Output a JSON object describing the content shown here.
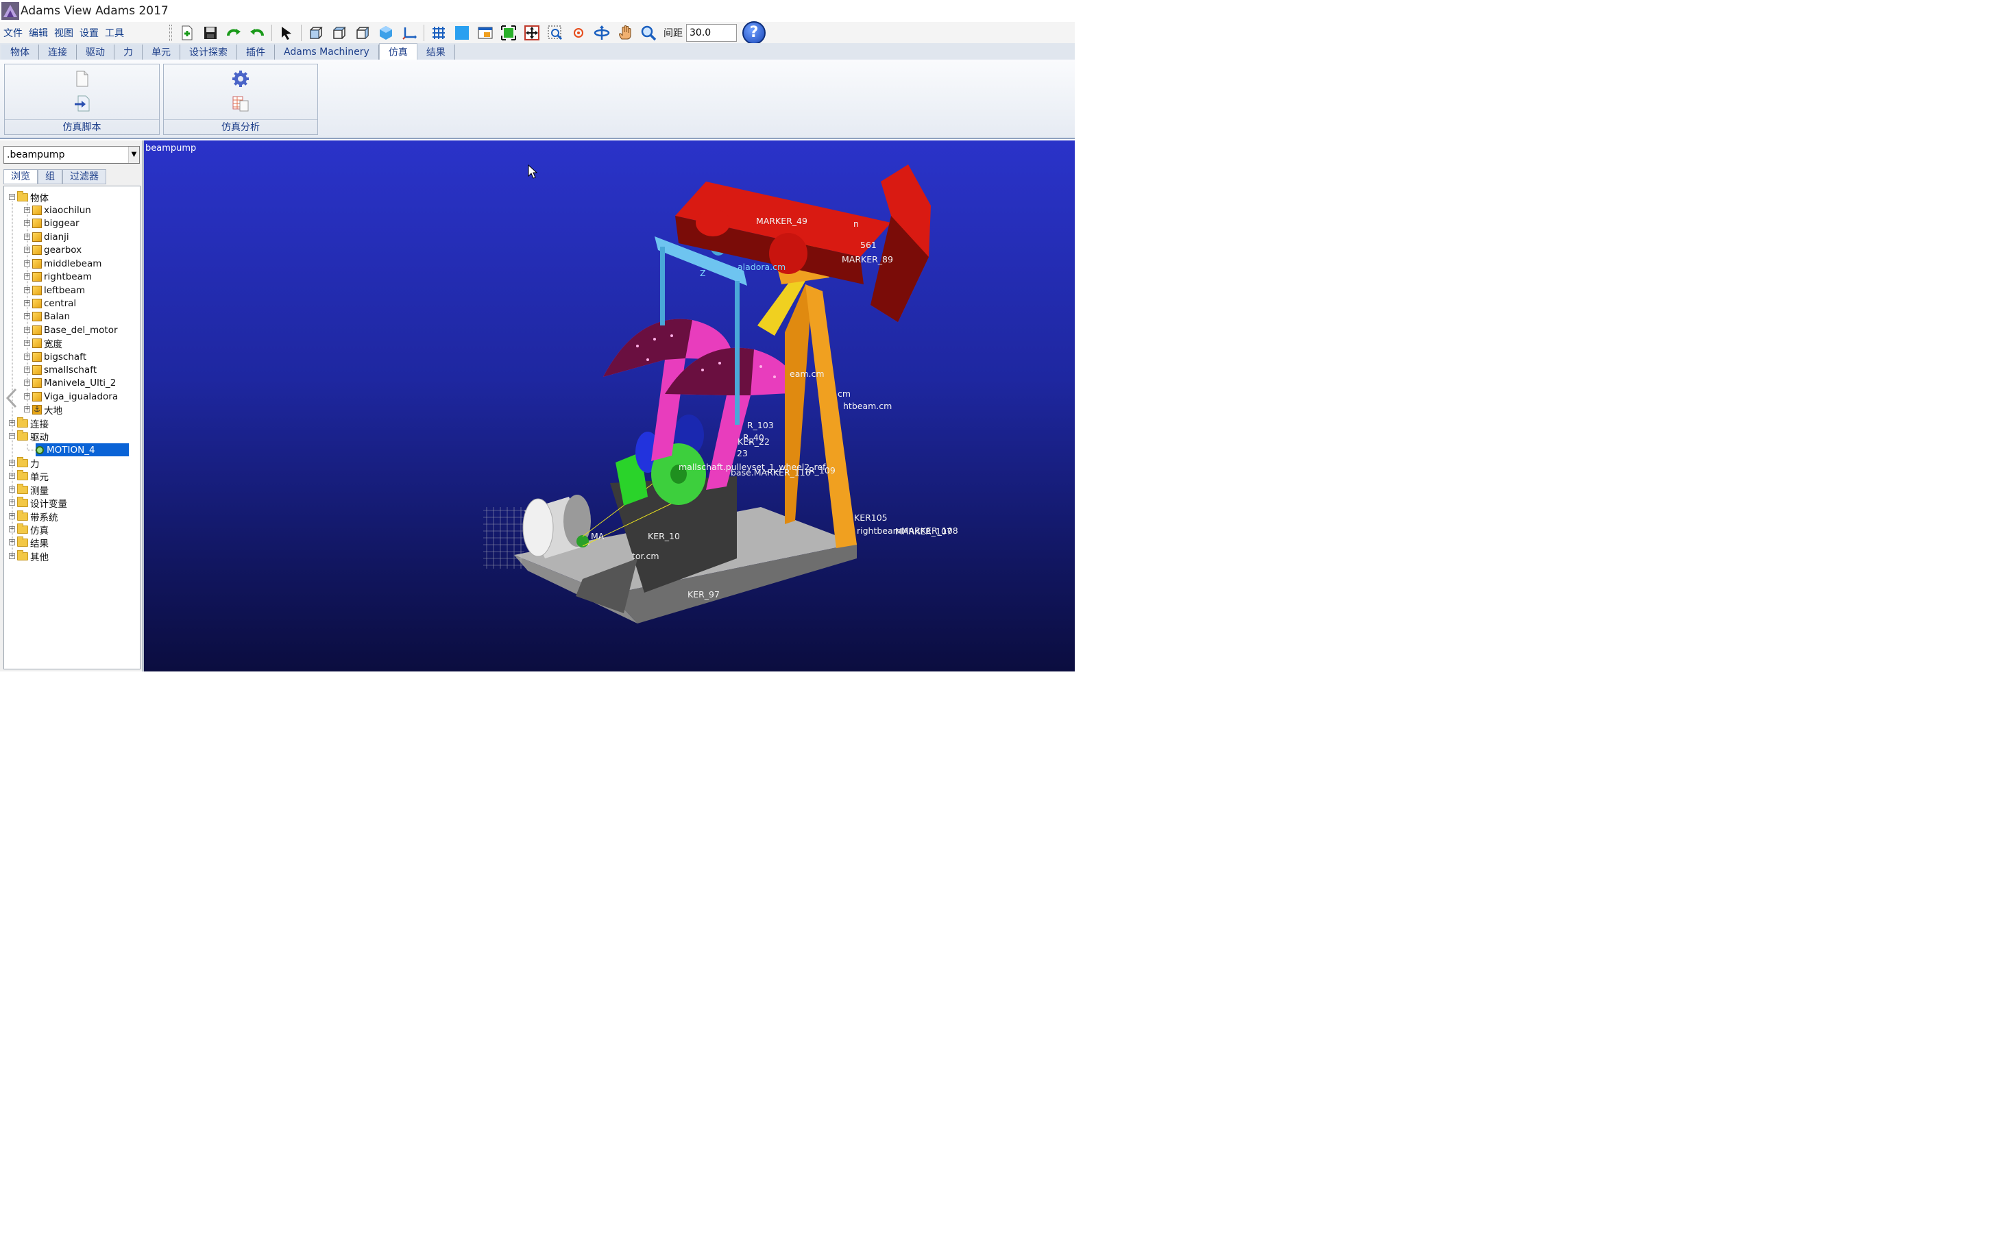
{
  "window": {
    "title": "Adams View Adams 2017"
  },
  "menu": [
    "文件",
    "编辑",
    "视图",
    "设置",
    "工具"
  ],
  "toolbar": {
    "spacing_label": "间距",
    "spacing_value": "30.0",
    "help_label": "?"
  },
  "ribbon_tabs": [
    {
      "label": "物体"
    },
    {
      "label": "连接"
    },
    {
      "label": "驱动"
    },
    {
      "label": "力"
    },
    {
      "label": "单元"
    },
    {
      "label": "设计探索"
    },
    {
      "label": "插件"
    },
    {
      "label": "Adams Machinery"
    },
    {
      "label": "仿真",
      "active": true
    },
    {
      "label": "结果"
    }
  ],
  "ribbon_groups": {
    "script": "仿真脚本",
    "analysis": "仿真分析"
  },
  "browser": {
    "model": ".beampump",
    "tabs": [
      "浏览",
      "组",
      "过滤器"
    ],
    "tree": [
      {
        "label": "物体",
        "exp": "-"
      },
      {
        "label": "xiaochilun"
      },
      {
        "label": "biggear"
      },
      {
        "label": "dianji"
      },
      {
        "label": "gearbox"
      },
      {
        "label": "middlebeam"
      },
      {
        "label": "rightbeam"
      },
      {
        "label": "leftbeam"
      },
      {
        "label": "central"
      },
      {
        "label": "Balan"
      },
      {
        "label": "Base_del_motor"
      },
      {
        "label": "宽度"
      },
      {
        "label": "bigschaft"
      },
      {
        "label": "smallschaft"
      },
      {
        "label": "Manivela_Ulti_2"
      },
      {
        "label": "Viga_igualadora"
      },
      {
        "label": "大地"
      },
      {
        "label": "连接",
        "exp": "+"
      },
      {
        "label": "驱动",
        "exp": "-"
      },
      {
        "label": "MOTION_4"
      },
      {
        "label": "力",
        "exp": "+"
      },
      {
        "label": "单元",
        "exp": "+"
      },
      {
        "label": "测量",
        "exp": "+"
      },
      {
        "label": "设计变量",
        "exp": "+"
      },
      {
        "label": "带系统",
        "exp": "+"
      },
      {
        "label": "仿真",
        "exp": "+"
      },
      {
        "label": "结果",
        "exp": "+"
      },
      {
        "label": "其他",
        "exp": "+"
      }
    ]
  },
  "viewport": {
    "model_label": "beampump",
    "markers": [
      "MARKER_49",
      "n",
      "561",
      "MARKER_89",
      "aladora.cm",
      "Z",
      "eam.cm",
      "cm",
      "htbeam.cm",
      "R_103",
      "R_40",
      "KER_22",
      "23",
      "mallschaft.pulleyset_1_wheel2_ref",
      "base.MARKER_116",
      "R_109",
      "MA",
      "KER_10",
      "tor.cm",
      "KER_97",
      "KER105",
      "rightbeamMARKER_108",
      "MARKER_107"
    ]
  },
  "colors": {
    "viewport_top": "#2a33c9",
    "viewport_bottom": "#0b0d3f",
    "beam": "#d91a12",
    "horsehead_dark": "#7a0c08",
    "post": "#f0a020",
    "counterweight": "#e83dbd",
    "hanger": "#6ec4f0",
    "gearbox": "#3bd13b",
    "gear": "#2233dd",
    "base": "#b0b0b0",
    "selection": "#0a63d6"
  }
}
